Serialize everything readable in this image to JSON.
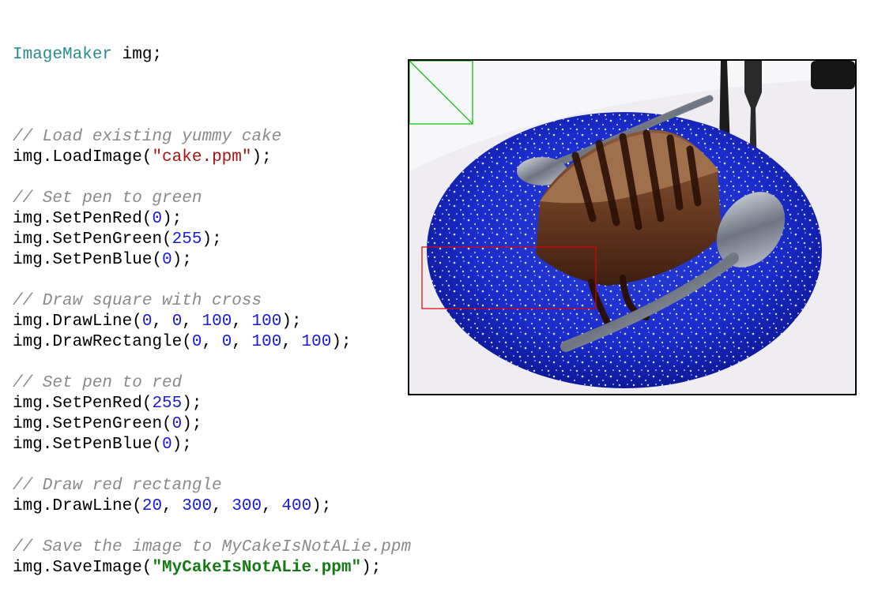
{
  "code": {
    "declaration": {
      "type": "ImageMaker",
      "rest": " img;"
    },
    "blocks": [
      {
        "comment": "// Load existing yummy cake",
        "lines": [
          {
            "obj": "img.",
            "method": "LoadImage",
            "args": [
              {
                "kind": "str",
                "text": "\"cake.ppm\""
              }
            ]
          }
        ]
      },
      {
        "comment": "// Set pen to green",
        "lines": [
          {
            "obj": "img.",
            "method": "SetPenRed",
            "args": [
              {
                "kind": "num",
                "text": "0"
              }
            ]
          },
          {
            "obj": "img.",
            "method": "SetPenGreen",
            "args": [
              {
                "kind": "num",
                "text": "255"
              }
            ]
          },
          {
            "obj": "img.",
            "method": "SetPenBlue",
            "args": [
              {
                "kind": "num",
                "text": "0"
              }
            ]
          }
        ]
      },
      {
        "comment": "// Draw square with cross",
        "lines": [
          {
            "obj": "img.",
            "method": "DrawLine",
            "args": [
              {
                "kind": "num",
                "text": "0"
              },
              {
                "kind": "num",
                "text": "0"
              },
              {
                "kind": "num",
                "text": "100"
              },
              {
                "kind": "num",
                "text": "100"
              }
            ]
          },
          {
            "obj": "img.",
            "method": "DrawRectangle",
            "args": [
              {
                "kind": "num",
                "text": "0"
              },
              {
                "kind": "num",
                "text": "0"
              },
              {
                "kind": "num",
                "text": "100"
              },
              {
                "kind": "num",
                "text": "100"
              }
            ]
          }
        ]
      },
      {
        "comment": "// Set pen to red",
        "lines": [
          {
            "obj": "img.",
            "method": "SetPenRed",
            "args": [
              {
                "kind": "num",
                "text": "255"
              }
            ]
          },
          {
            "obj": "img.",
            "method": "SetPenGreen",
            "args": [
              {
                "kind": "num",
                "text": "0"
              }
            ]
          },
          {
            "obj": "img.",
            "method": "SetPenBlue",
            "args": [
              {
                "kind": "num",
                "text": "0"
              }
            ]
          }
        ]
      },
      {
        "comment": "// Draw red rectangle",
        "lines": [
          {
            "obj": "img.",
            "method": "DrawLine",
            "args": [
              {
                "kind": "num",
                "text": "20"
              },
              {
                "kind": "num",
                "text": "300"
              },
              {
                "kind": "num",
                "text": "300"
              },
              {
                "kind": "num",
                "text": "400"
              }
            ]
          }
        ]
      },
      {
        "comment": "// Save the image to MyCakeIsNotALie.ppm",
        "lines": [
          {
            "obj": "img.",
            "method": "SaveImage",
            "args": [
              {
                "kind": "strbold",
                "text": "\"MyCakeIsNotALie.ppm\""
              }
            ]
          }
        ]
      }
    ]
  },
  "photo": {
    "subject": "cake-photo",
    "overlay_colors": {
      "green": "#00c000",
      "red": "#e00000"
    }
  }
}
